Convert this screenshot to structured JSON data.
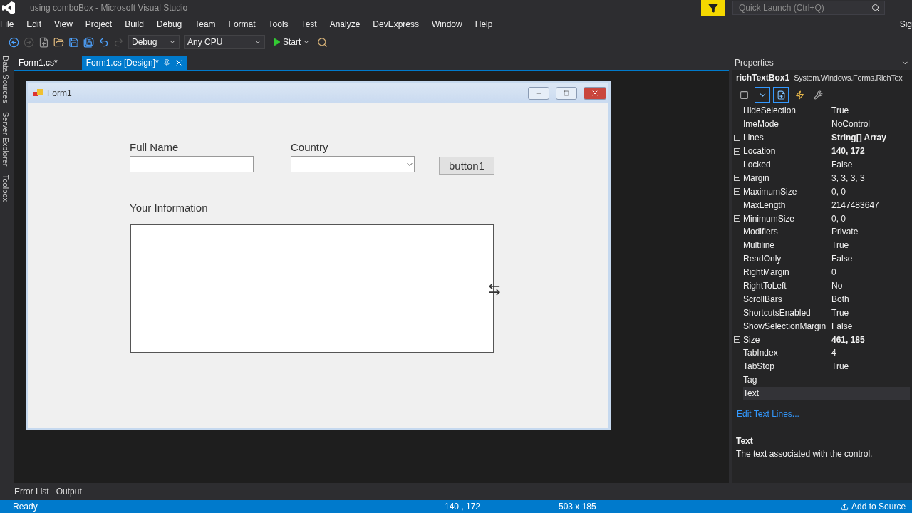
{
  "window": {
    "title": "using comboBox - Microsoft Visual Studio",
    "quick_launch": {
      "placeholder": "Quick Launch (Ctrl+Q)"
    },
    "sign_in": "Sig"
  },
  "menu": [
    "File",
    "Edit",
    "View",
    "Project",
    "Build",
    "Debug",
    "Team",
    "Format",
    "Tools",
    "Test",
    "Analyze",
    "DevExpress",
    "Window",
    "Help"
  ],
  "toolbar": {
    "configuration": "Debug",
    "platform": "Any CPU",
    "start": "Start"
  },
  "side_tabs": [
    "Data Sources",
    "Server Explorer",
    "Toolbox"
  ],
  "doc_tabs": [
    {
      "label": "Form1.cs*",
      "selected": false
    },
    {
      "label": "Form1.cs [Design]*",
      "selected": true
    }
  ],
  "form": {
    "title": "Form1",
    "full_name_label": "Full Name",
    "country_label": "Country",
    "button": "button1",
    "info_label": "Your Information",
    "rich_textbox": {
      "selected": true
    }
  },
  "properties": {
    "title": "Properties",
    "object_name": "richTextBox1",
    "object_type": "System.Windows.Forms.RichTex",
    "rows": [
      {
        "name": "HideSelection",
        "value": "True",
        "expandable": false,
        "modified": false,
        "selected": false
      },
      {
        "name": "ImeMode",
        "value": "NoControl",
        "expandable": false,
        "modified": false,
        "selected": false
      },
      {
        "name": "Lines",
        "value": "String[] Array",
        "expandable": true,
        "modified": true,
        "selected": false
      },
      {
        "name": "Location",
        "value": "140, 172",
        "expandable": true,
        "modified": true,
        "selected": false
      },
      {
        "name": "Locked",
        "value": "False",
        "expandable": false,
        "modified": false,
        "selected": false
      },
      {
        "name": "Margin",
        "value": "3, 3, 3, 3",
        "expandable": true,
        "modified": false,
        "selected": false
      },
      {
        "name": "MaximumSize",
        "value": "0, 0",
        "expandable": true,
        "modified": false,
        "selected": false
      },
      {
        "name": "MaxLength",
        "value": "2147483647",
        "expandable": false,
        "modified": false,
        "selected": false
      },
      {
        "name": "MinimumSize",
        "value": "0, 0",
        "expandable": true,
        "modified": false,
        "selected": false
      },
      {
        "name": "Modifiers",
        "value": "Private",
        "expandable": false,
        "modified": false,
        "selected": false
      },
      {
        "name": "Multiline",
        "value": "True",
        "expandable": false,
        "modified": false,
        "selected": false
      },
      {
        "name": "ReadOnly",
        "value": "False",
        "expandable": false,
        "modified": false,
        "selected": false
      },
      {
        "name": "RightMargin",
        "value": "0",
        "expandable": false,
        "modified": false,
        "selected": false
      },
      {
        "name": "RightToLeft",
        "value": "No",
        "expandable": false,
        "modified": false,
        "selected": false
      },
      {
        "name": "ScrollBars",
        "value": "Both",
        "expandable": false,
        "modified": false,
        "selected": false
      },
      {
        "name": "ShortcutsEnabled",
        "value": "True",
        "expandable": false,
        "modified": false,
        "selected": false
      },
      {
        "name": "ShowSelectionMargin",
        "value": "False",
        "expandable": false,
        "modified": false,
        "selected": false
      },
      {
        "name": "Size",
        "value": "461, 185",
        "expandable": true,
        "modified": true,
        "selected": false
      },
      {
        "name": "TabIndex",
        "value": "4",
        "expandable": false,
        "modified": false,
        "selected": false
      },
      {
        "name": "TabStop",
        "value": "True",
        "expandable": false,
        "modified": false,
        "selected": false
      },
      {
        "name": "Tag",
        "expandable": false,
        "modified": false,
        "selected": false
      },
      {
        "name": "Text",
        "expandable": false,
        "modified": false,
        "selected": true
      }
    ],
    "command_link": "Edit Text Lines...",
    "description_title": "Text",
    "description": "The text associated with the control."
  },
  "bottom_tabs": [
    "Error List",
    "Output"
  ],
  "status_bar": {
    "text": "Ready",
    "position": "140 , 172",
    "size": "503 x 185",
    "source_control": "Add to Source"
  }
}
